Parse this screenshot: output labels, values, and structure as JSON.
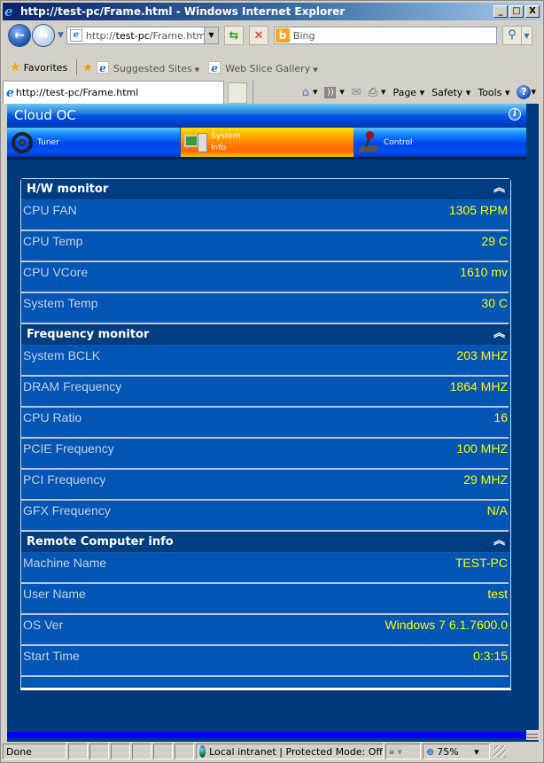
{
  "window": {
    "title": "http://test-pc/Frame.html - Windows Internet Explorer",
    "minimize_label": "_",
    "maximize_label": "□",
    "close_label": "X"
  },
  "navigation": {
    "back_icon": "←",
    "forward_icon": "→",
    "address_prefix": "http://",
    "address_host": "test-pc",
    "address_suffix": "/Frame.htm",
    "address_dropdown": "▼",
    "refresh_icon": "⇆",
    "stop_icon": "✕",
    "search_placeholder": "Bing",
    "search_engine_icon": "b",
    "search_go_icon": "⚲",
    "search_dropdown": "▼"
  },
  "favorites": {
    "label": "Favorites",
    "links": [
      {
        "label": "Suggested Sites"
      },
      {
        "label": "Web Slice Gallery"
      }
    ]
  },
  "tab": {
    "label": "http://test-pc/Frame.html"
  },
  "commandbar": {
    "page": "Page",
    "safety": "Safety",
    "tools": "Tools",
    "help_icon": "?",
    "caret": "▾"
  },
  "app": {
    "title": "Cloud OC",
    "info_icon": "i",
    "nav": [
      {
        "label": "Tuner",
        "icon": "steering-wheel",
        "active": false
      },
      {
        "label_line1": "System",
        "label_line2": "Info",
        "icon": "computer",
        "active": true
      },
      {
        "label": "Control",
        "icon": "joystick",
        "active": false
      }
    ],
    "collapse_icon": "︽",
    "sections": [
      {
        "title": "H/W monitor",
        "rows": [
          {
            "label": "CPU FAN",
            "value": "1305 RPM"
          },
          {
            "label": "CPU Temp",
            "value": "29 C"
          },
          {
            "label": "CPU VCore",
            "value": "1610 mv"
          },
          {
            "label": "System Temp",
            "value": "30 C"
          }
        ]
      },
      {
        "title": "Frequency monitor",
        "rows": [
          {
            "label": "System BCLK",
            "value": "203 MHZ"
          },
          {
            "label": "DRAM Frequency",
            "value": "1864 MHZ"
          },
          {
            "label": "CPU Ratio",
            "value": "16"
          },
          {
            "label": "PCIE Frequency",
            "value": "100 MHZ"
          },
          {
            "label": "PCI Frequency",
            "value": "29 MHZ"
          },
          {
            "label": "GFX Frequency",
            "value": "N/A"
          }
        ]
      },
      {
        "title": "Remote Computer info",
        "rows": [
          {
            "label": "Machine Name",
            "value": "TEST-PC"
          },
          {
            "label": "User Name",
            "value": "test"
          },
          {
            "label": "OS Ver",
            "value": "Windows 7 6.1.7600.0"
          },
          {
            "label": "Start Time",
            "value": "0:3:15"
          }
        ]
      }
    ]
  },
  "statusbar": {
    "status": "Done",
    "zone": "Local intranet | Protected Mode: Off",
    "zoom": "75%",
    "caret": "▾"
  }
}
